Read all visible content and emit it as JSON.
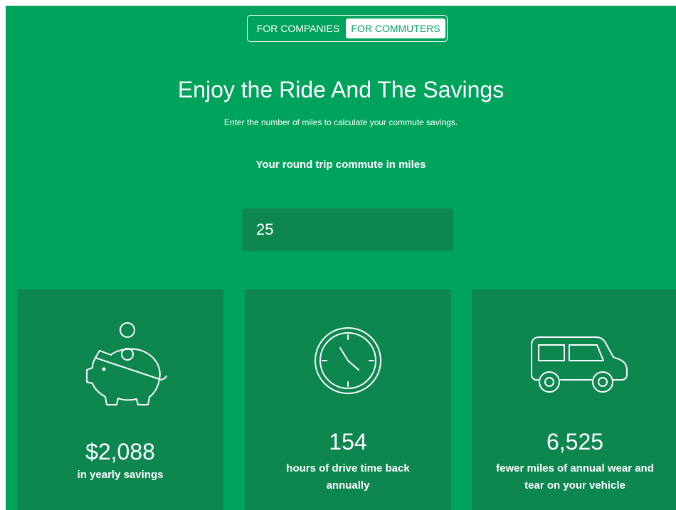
{
  "toggle": {
    "companies_label": "FOR COMPANIES",
    "commuters_label": "FOR COMMUTERS"
  },
  "hero": {
    "title": "Enjoy the Ride And The Savings",
    "subtitle": "Enter the number of miles to calculate your commute savings."
  },
  "calculator": {
    "label": "Your round trip commute in miles",
    "value": "25"
  },
  "results": [
    {
      "icon": "piggy-bank-icon",
      "value": "$2,088",
      "description": "in yearly savings"
    },
    {
      "icon": "clock-icon",
      "value": "154",
      "description": "hours of drive time back annually"
    },
    {
      "icon": "van-icon",
      "value": "6,525",
      "description": "fewer miles of annual wear and tear on your vehicle"
    }
  ],
  "colors": {
    "background_green": "#00a35c",
    "card_green": "#0d8650",
    "text": "#ffffff"
  }
}
